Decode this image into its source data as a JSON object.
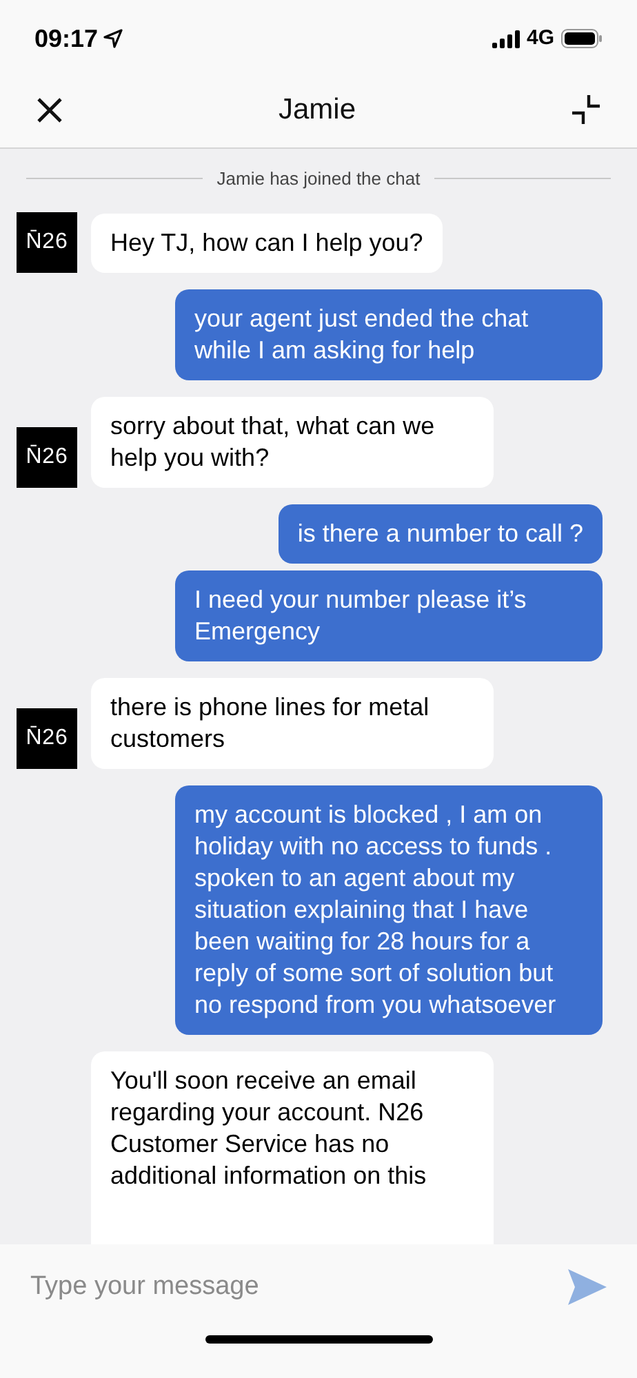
{
  "status_bar": {
    "time": "09:17",
    "network": "4G"
  },
  "header": {
    "title": "Jamie"
  },
  "system_notice": "Jamie has joined the chat",
  "messages": [
    {
      "kind": "agent",
      "avatar": "N̄26",
      "text": "Hey TJ, how can I help you?"
    },
    {
      "kind": "user",
      "text": "your agent just ended the chat while I am asking for help"
    },
    {
      "kind": "agent",
      "avatar": "N̄26",
      "text": "sorry about that, what can we help you with?"
    },
    {
      "kind": "user",
      "text": "is there a number to call ?"
    },
    {
      "kind": "user",
      "text": "I need your number please it’s Emergency"
    },
    {
      "kind": "agent",
      "avatar": "N̄26",
      "text": "there is phone lines for metal customers"
    },
    {
      "kind": "user",
      "text": "my account is blocked , I am on holiday with no access to funds . spoken to an agent about my situation explaining that I have been waiting for 28 hours for a reply of some sort of solution but no respond from you whatsoever"
    },
    {
      "kind": "agent",
      "text": "You'll soon receive an email regarding your account. N26 Customer Service has no additional information on this"
    }
  ],
  "composer": {
    "placeholder": "Type your message"
  }
}
